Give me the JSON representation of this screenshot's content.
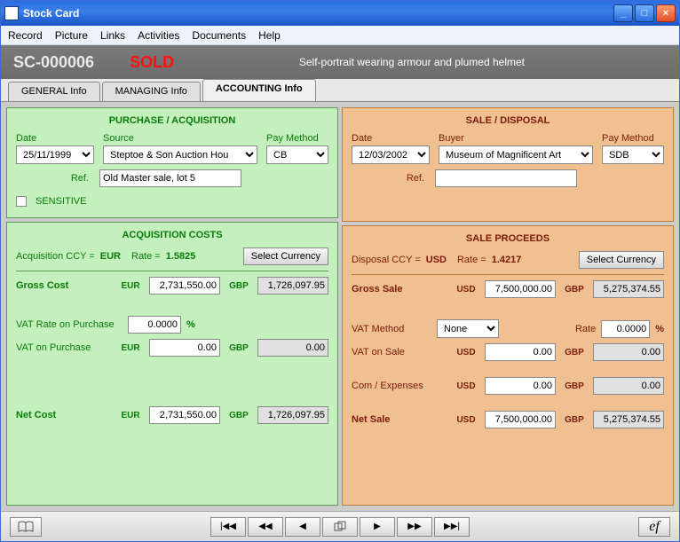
{
  "window": {
    "title": "Stock Card"
  },
  "menu": [
    "Record",
    "Picture",
    "Links",
    "Activities",
    "Documents",
    "Help"
  ],
  "header": {
    "sc": "SC-000006",
    "status": "SOLD",
    "desc": "Self-portrait wearing armour and plumed helmet"
  },
  "tabs": {
    "general": "GENERAL Info",
    "managing": "MANAGING Info",
    "accounting": "ACCOUNTING Info"
  },
  "purchase": {
    "heading": "PURCHASE / ACQUISITION",
    "date_label": "Date",
    "date": "25/11/1999",
    "source_label": "Source",
    "source": "Steptoe & Son Auction Hou",
    "paymethod_label": "Pay Method",
    "paymethod": "CB",
    "ref_label": "Ref.",
    "ref": "Old Master sale, lot 5",
    "sensitive": "SENSITIVE"
  },
  "sale": {
    "heading": "SALE / DISPOSAL",
    "date_label": "Date",
    "date": "12/03/2002",
    "buyer_label": "Buyer",
    "buyer": "Museum of Magnificent Art",
    "paymethod_label": "Pay Method",
    "paymethod": "SDB",
    "ref_label": "Ref.",
    "ref": ""
  },
  "acq": {
    "heading": "ACQUISITION COSTS",
    "ccy_label": "Acquisition CCY  =",
    "ccy": "EUR",
    "rate_label": "Rate  =",
    "rate": "1.5825",
    "select_btn": "Select Currency",
    "gross_label": "Gross Cost",
    "gross_ccy1": "EUR",
    "gross_v1": "2,731,550.00",
    "gross_ccy2": "GBP",
    "gross_v2": "1,726,097.95",
    "vatrate_label": "VAT Rate on Purchase",
    "vatrate": "0.0000",
    "pct": "%",
    "vat_label": "VAT on Purchase",
    "vat_v1": "0.00",
    "vat_v2": "0.00",
    "net_label": "Net Cost",
    "net_v1": "2,731,550.00",
    "net_v2": "1,726,097.95"
  },
  "proc": {
    "heading": "SALE PROCEEDS",
    "ccy_label": "Disposal CCY  =",
    "ccy": "USD",
    "rate_label": "Rate  =",
    "rate": "1.4217",
    "select_btn": "Select Currency",
    "gross_label": "Gross Sale",
    "gross_ccy1": "USD",
    "gross_v1": "7,500,000.00",
    "gross_ccy2": "GBP",
    "gross_v2": "5,275,374.55",
    "vatmethod_label": "VAT Method",
    "vatmethod": "None",
    "rate2_label": "Rate",
    "vatrate": "0.0000",
    "pct": "%",
    "vat_label": "VAT on Sale",
    "vat_v1": "0.00",
    "vat_v2": "0.00",
    "com_label": "Com / Expenses",
    "com_v1": "0.00",
    "com_v2": "0.00",
    "net_label": "Net Sale",
    "net_v1": "7,500,000.00",
    "net_v2": "5,275,374.55"
  }
}
